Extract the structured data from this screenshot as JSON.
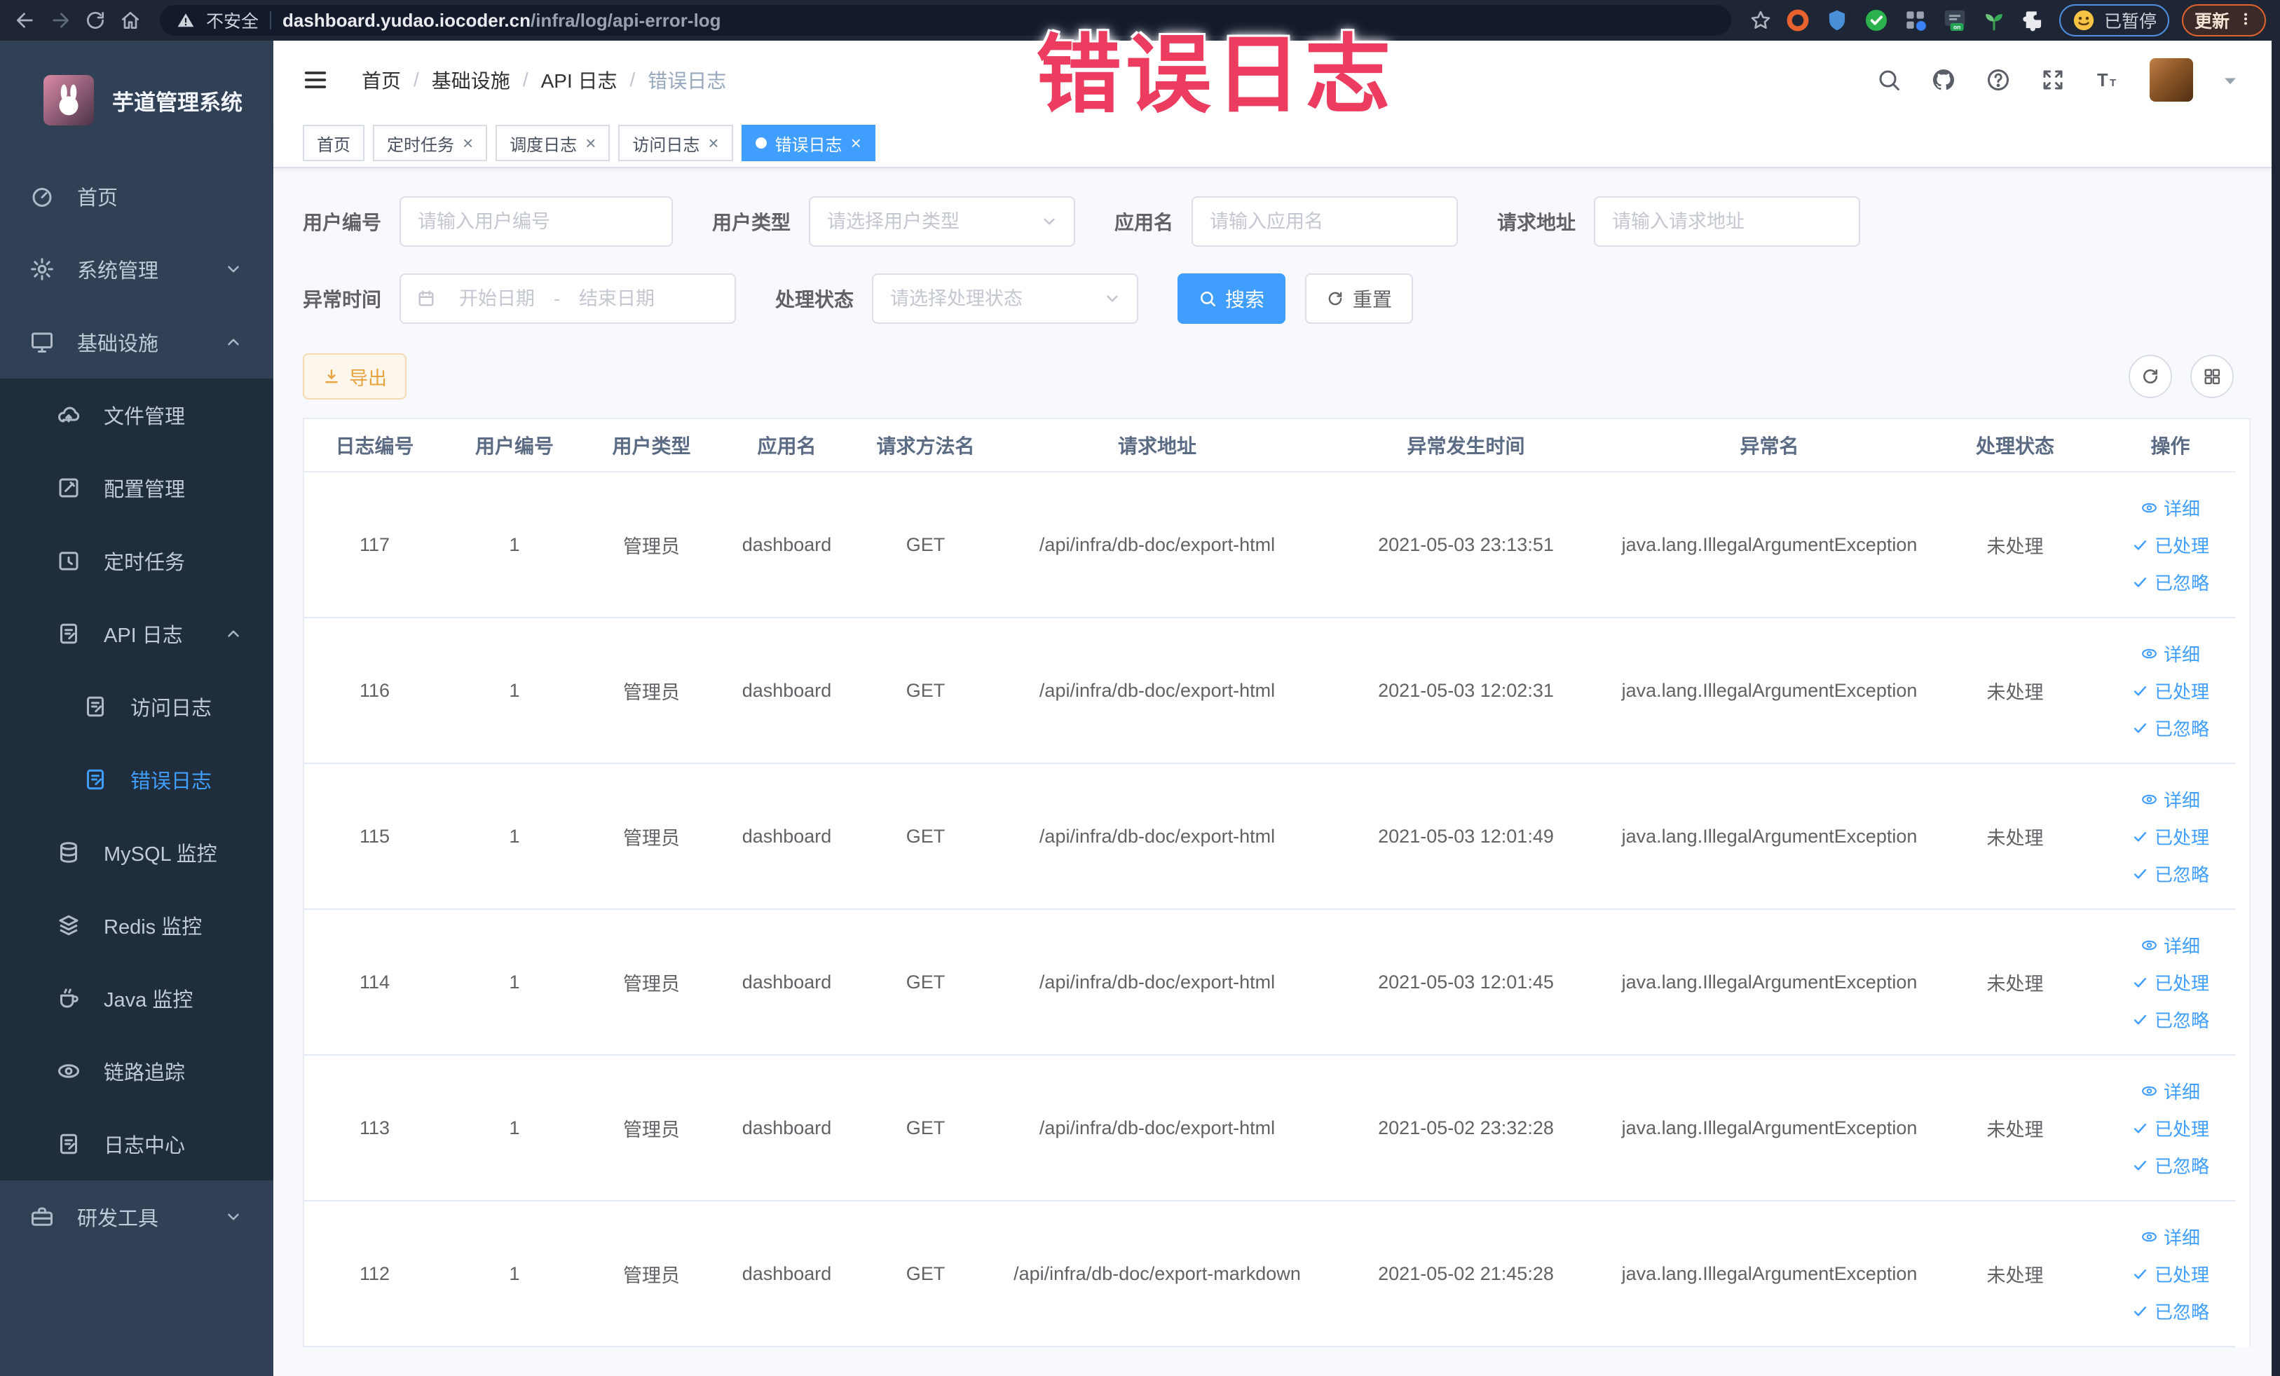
{
  "colors": {
    "accent": "#409eff",
    "overlay": "#ec3c5f",
    "warning-text": "#e6a23c",
    "warning-bg": "#fdf6ec",
    "warning-border": "#f5dab1"
  },
  "overlay_title": "错误日志",
  "browser": {
    "security_label": "不安全",
    "url_host": "dashboard.yudao.iocoder.cn",
    "url_path": "/infra/log/api-error-log",
    "profile_badge": "已暂停",
    "update_button": "更新"
  },
  "sidebar": {
    "app_title": "芋道管理系统",
    "items": [
      {
        "label": "首页"
      },
      {
        "label": "系统管理"
      },
      {
        "label": "基础设施"
      },
      {
        "label": "文件管理"
      },
      {
        "label": "配置管理"
      },
      {
        "label": "定时任务"
      },
      {
        "label": "API 日志"
      },
      {
        "label": "访问日志"
      },
      {
        "label": "错误日志"
      },
      {
        "label": "MySQL 监控"
      },
      {
        "label": "Redis 监控"
      },
      {
        "label": "Java 监控"
      },
      {
        "label": "链路追踪"
      },
      {
        "label": "日志中心"
      },
      {
        "label": "研发工具"
      }
    ]
  },
  "breadcrumb": {
    "separator": "/",
    "items": [
      "首页",
      "基础设施",
      "API 日志",
      "错误日志"
    ]
  },
  "tabs": [
    {
      "label": "首页"
    },
    {
      "label": "定时任务"
    },
    {
      "label": "调度日志"
    },
    {
      "label": "访问日志"
    },
    {
      "label": "错误日志"
    }
  ],
  "filters": {
    "user_id_label": "用户编号",
    "user_id_placeholder": "请输入用户编号",
    "user_type_label": "用户类型",
    "user_type_placeholder": "请选择用户类型",
    "app_name_label": "应用名",
    "app_name_placeholder": "请输入应用名",
    "request_url_label": "请求地址",
    "request_url_placeholder": "请输入请求地址",
    "time_label": "异常时间",
    "time_start_placeholder": "开始日期",
    "time_separator": "-",
    "time_end_placeholder": "结束日期",
    "status_label": "处理状态",
    "status_placeholder": "请选择处理状态",
    "search_button": "搜索",
    "reset_button": "重置"
  },
  "toolbar": {
    "export_button": "导出"
  },
  "table": {
    "columns": [
      "日志编号",
      "用户编号",
      "用户类型",
      "应用名",
      "请求方法名",
      "请求地址",
      "异常发生时间",
      "异常名",
      "处理状态",
      "操作"
    ],
    "actions": [
      "详细",
      "已处理",
      "已忽略"
    ],
    "rows": [
      {
        "id": "117",
        "user_id": "1",
        "user_type": "管理员",
        "app": "dashboard",
        "method": "GET",
        "url": "/api/infra/db-doc/export-html",
        "time": "2021-05-03 23:13:51",
        "exception": "java.lang.IllegalArgumentException",
        "status": "未处理"
      },
      {
        "id": "116",
        "user_id": "1",
        "user_type": "管理员",
        "app": "dashboard",
        "method": "GET",
        "url": "/api/infra/db-doc/export-html",
        "time": "2021-05-03 12:02:31",
        "exception": "java.lang.IllegalArgumentException",
        "status": "未处理"
      },
      {
        "id": "115",
        "user_id": "1",
        "user_type": "管理员",
        "app": "dashboard",
        "method": "GET",
        "url": "/api/infra/db-doc/export-html",
        "time": "2021-05-03 12:01:49",
        "exception": "java.lang.IllegalArgumentException",
        "status": "未处理"
      },
      {
        "id": "114",
        "user_id": "1",
        "user_type": "管理员",
        "app": "dashboard",
        "method": "GET",
        "url": "/api/infra/db-doc/export-html",
        "time": "2021-05-03 12:01:45",
        "exception": "java.lang.IllegalArgumentException",
        "status": "未处理"
      },
      {
        "id": "113",
        "user_id": "1",
        "user_type": "管理员",
        "app": "dashboard",
        "method": "GET",
        "url": "/api/infra/db-doc/export-html",
        "time": "2021-05-02 23:32:28",
        "exception": "java.lang.IllegalArgumentException",
        "status": "未处理"
      },
      {
        "id": "112",
        "user_id": "1",
        "user_type": "管理员",
        "app": "dashboard",
        "method": "GET",
        "url": "/api/infra/db-doc/export-markdown",
        "time": "2021-05-02 21:45:28",
        "exception": "java.lang.IllegalArgumentException",
        "status": "未处理"
      }
    ]
  }
}
